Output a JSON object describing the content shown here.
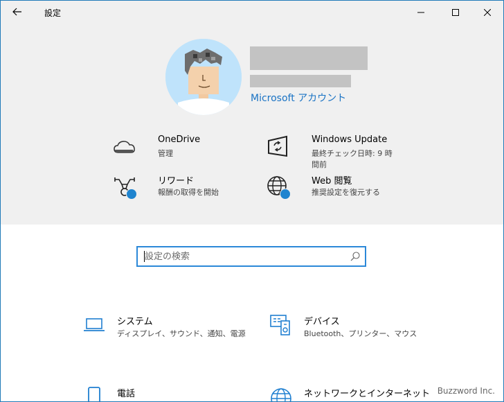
{
  "window": {
    "title": "設定"
  },
  "account": {
    "link_label": "Microsoft アカウント"
  },
  "quick_links": [
    {
      "title": "OneDrive",
      "subtitle": "管理",
      "icon": "cloud-icon"
    },
    {
      "title": "Windows Update",
      "subtitle": "最終チェック日時: 9 時間前",
      "icon": "update-icon"
    },
    {
      "title": "リワード",
      "subtitle": "報酬の取得を開始",
      "icon": "rewards-icon"
    },
    {
      "title": "Web 閲覧",
      "subtitle": "推奨設定を復元する",
      "icon": "globe-icon"
    }
  ],
  "search": {
    "placeholder": "設定の検索"
  },
  "categories": [
    {
      "title": "システム",
      "subtitle": "ディスプレイ、サウンド、通知、電源",
      "icon": "laptop-icon"
    },
    {
      "title": "デバイス",
      "subtitle": "Bluetooth、プリンター、マウス",
      "icon": "devices-icon"
    },
    {
      "title": "電話",
      "subtitle": "",
      "icon": "phone-icon"
    },
    {
      "title": "ネットワークとインターネット",
      "subtitle": "",
      "icon": "network-globe-icon"
    }
  ],
  "watermark": "Buzzword Inc.",
  "colors": {
    "accent": "#1a73c4",
    "header_bg": "#f0f0f0",
    "badge": "#1f84cf"
  }
}
